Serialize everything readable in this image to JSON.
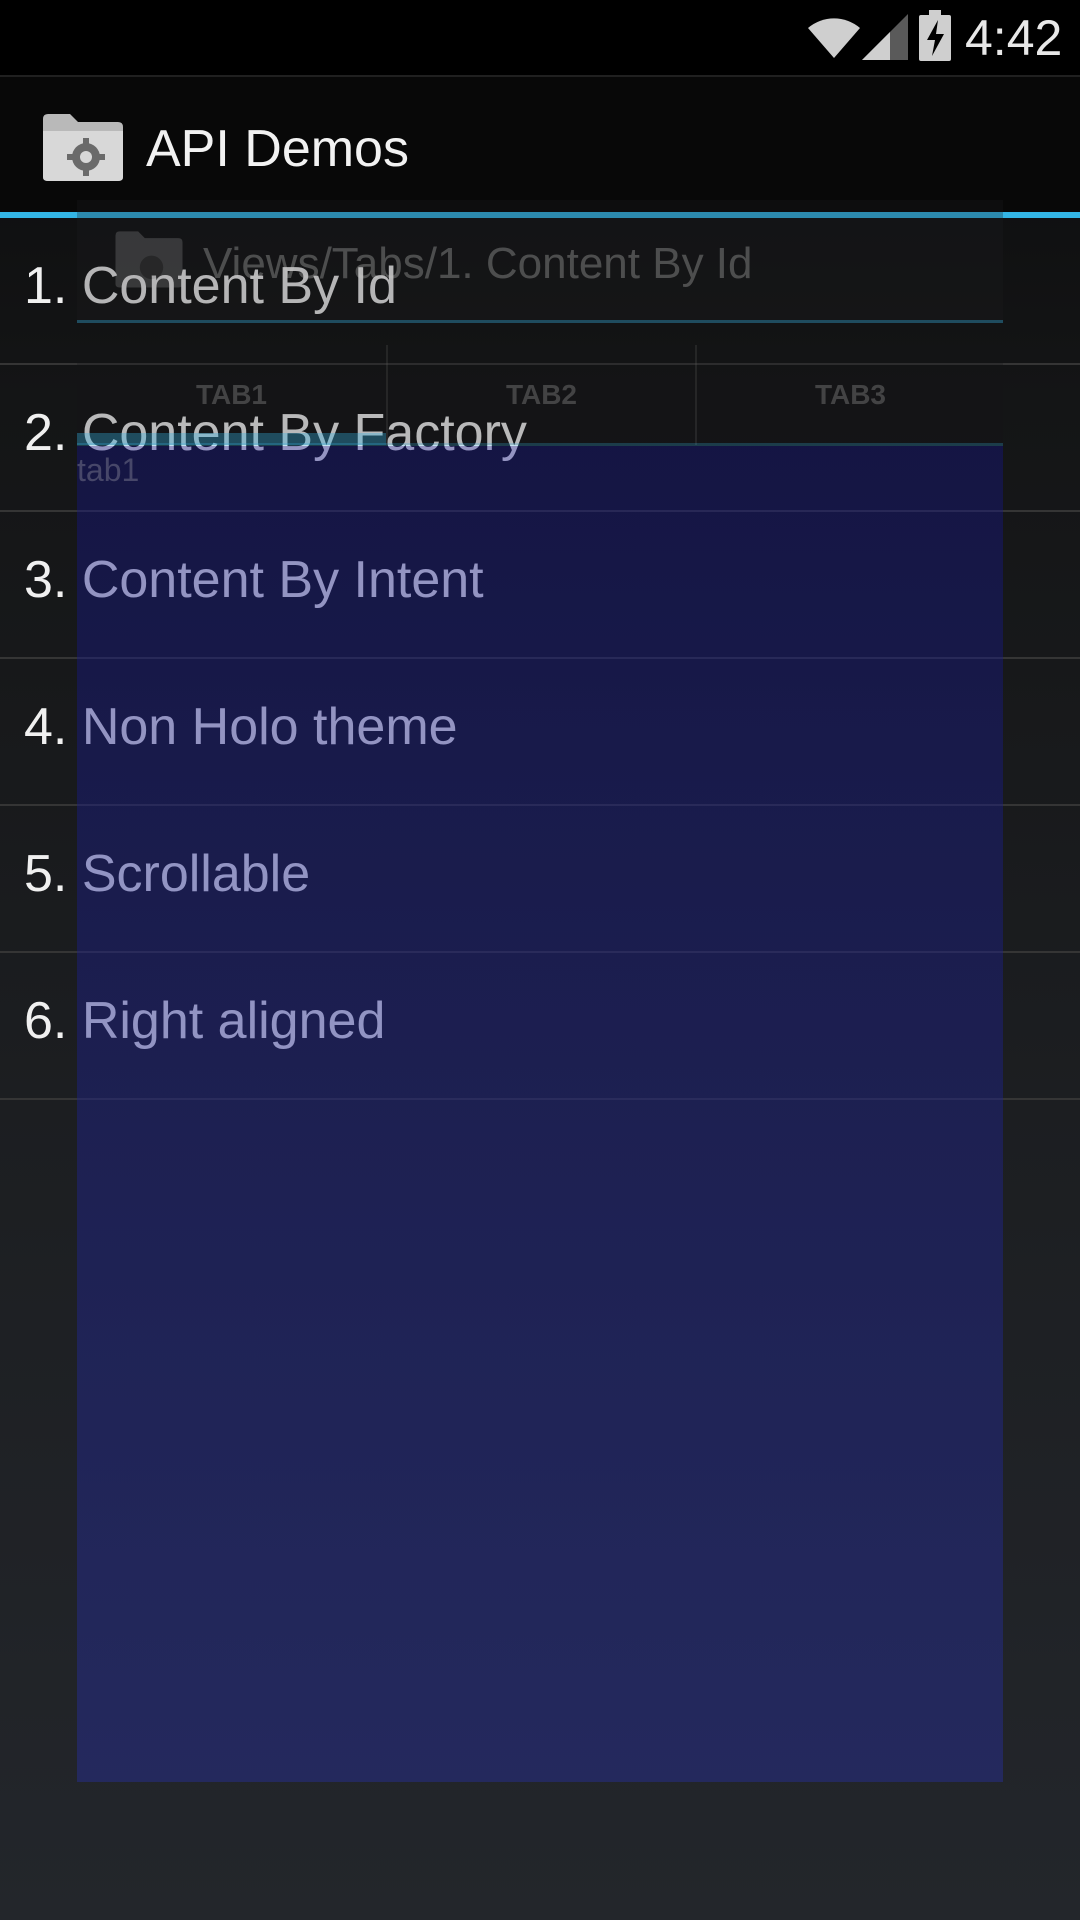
{
  "status_bar": {
    "time": "4:42",
    "icons": [
      "wifi-icon",
      "cell-signal-icon",
      "battery-charging-icon"
    ]
  },
  "action_bar": {
    "title": "API Demos",
    "icon": "folder-gear-icon",
    "accent_color": "#33b5e5"
  },
  "list": {
    "items": [
      {
        "label": "1. Content By Id"
      },
      {
        "label": "2. Content By Factory"
      },
      {
        "label": "3. Content By Intent"
      },
      {
        "label": "4. Non Holo theme"
      },
      {
        "label": "5. Scrollable"
      },
      {
        "label": "6. Right aligned"
      }
    ]
  },
  "overlay": {
    "title": "Views/Tabs/1. Content By Id",
    "tabs": [
      "TAB1",
      "TAB2",
      "TAB3"
    ],
    "selected_tab": "TAB1",
    "content_text": "tab1"
  }
}
